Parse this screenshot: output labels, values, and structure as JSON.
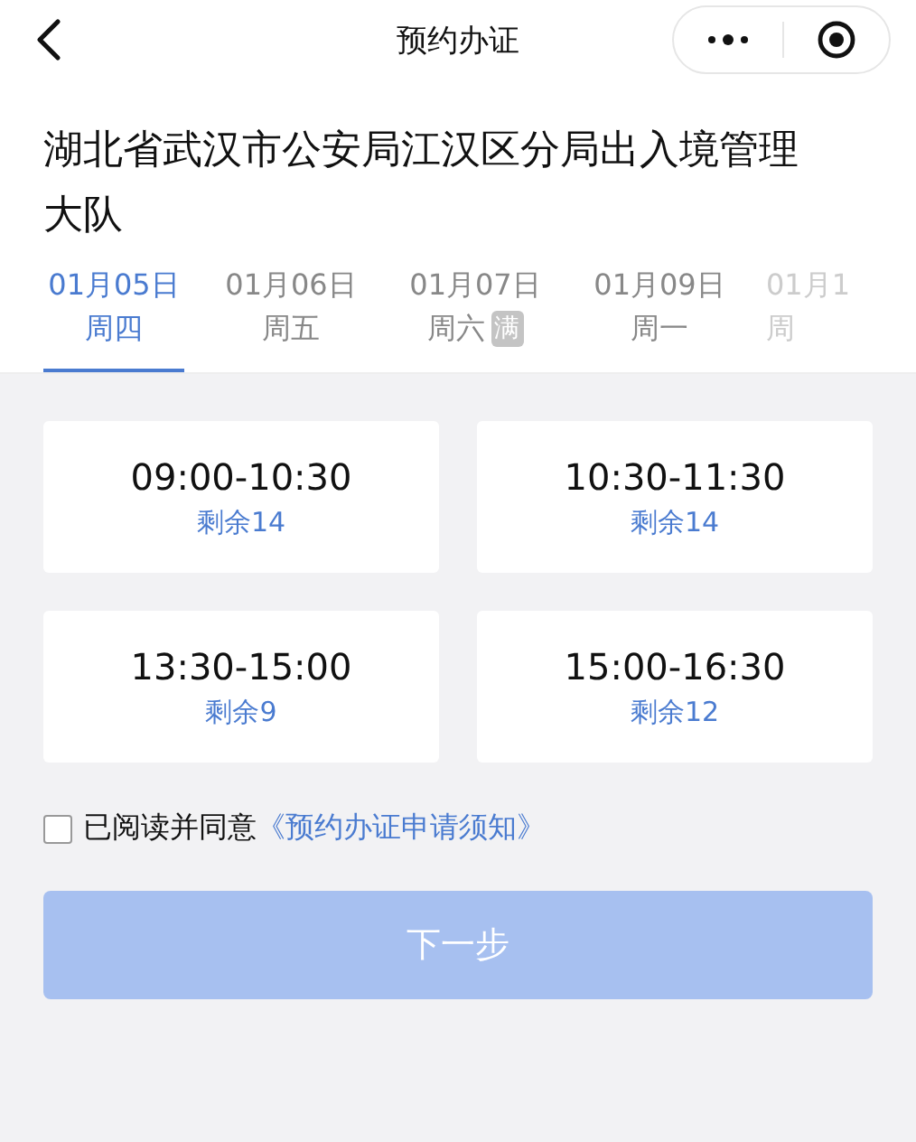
{
  "nav_bar": {
    "title": "预约办证"
  },
  "office": "湖北省武汉市公安局江汉区分局出入境管理大队",
  "date_tabs": [
    {
      "date": "01月05日",
      "weekday": "周四",
      "selected": true,
      "faded": false
    },
    {
      "date": "01月06日",
      "weekday": "周五",
      "selected": false,
      "faded": false
    },
    {
      "date": "01月07日",
      "weekday": "周六",
      "badge": "满",
      "selected": false,
      "faded": false
    },
    {
      "date": "01月09日",
      "weekday": "周一",
      "selected": false,
      "faded": false
    },
    {
      "date": "01月1",
      "weekday": "周",
      "selected": false,
      "faded": true
    }
  ],
  "time_slots": [
    {
      "time": "09:00-10:30",
      "remaining": "剩余14"
    },
    {
      "time": "10:30-11:30",
      "remaining": "剩余14"
    },
    {
      "time": "13:30-15:00",
      "remaining": "剩余9"
    },
    {
      "time": "15:00-16:30",
      "remaining": "剩余12"
    }
  ],
  "agreement": {
    "checked": false,
    "text": "已阅读并同意",
    "link": "《预约办证申请须知》"
  },
  "next_button": {
    "label": "下一步",
    "disabled": true
  }
}
